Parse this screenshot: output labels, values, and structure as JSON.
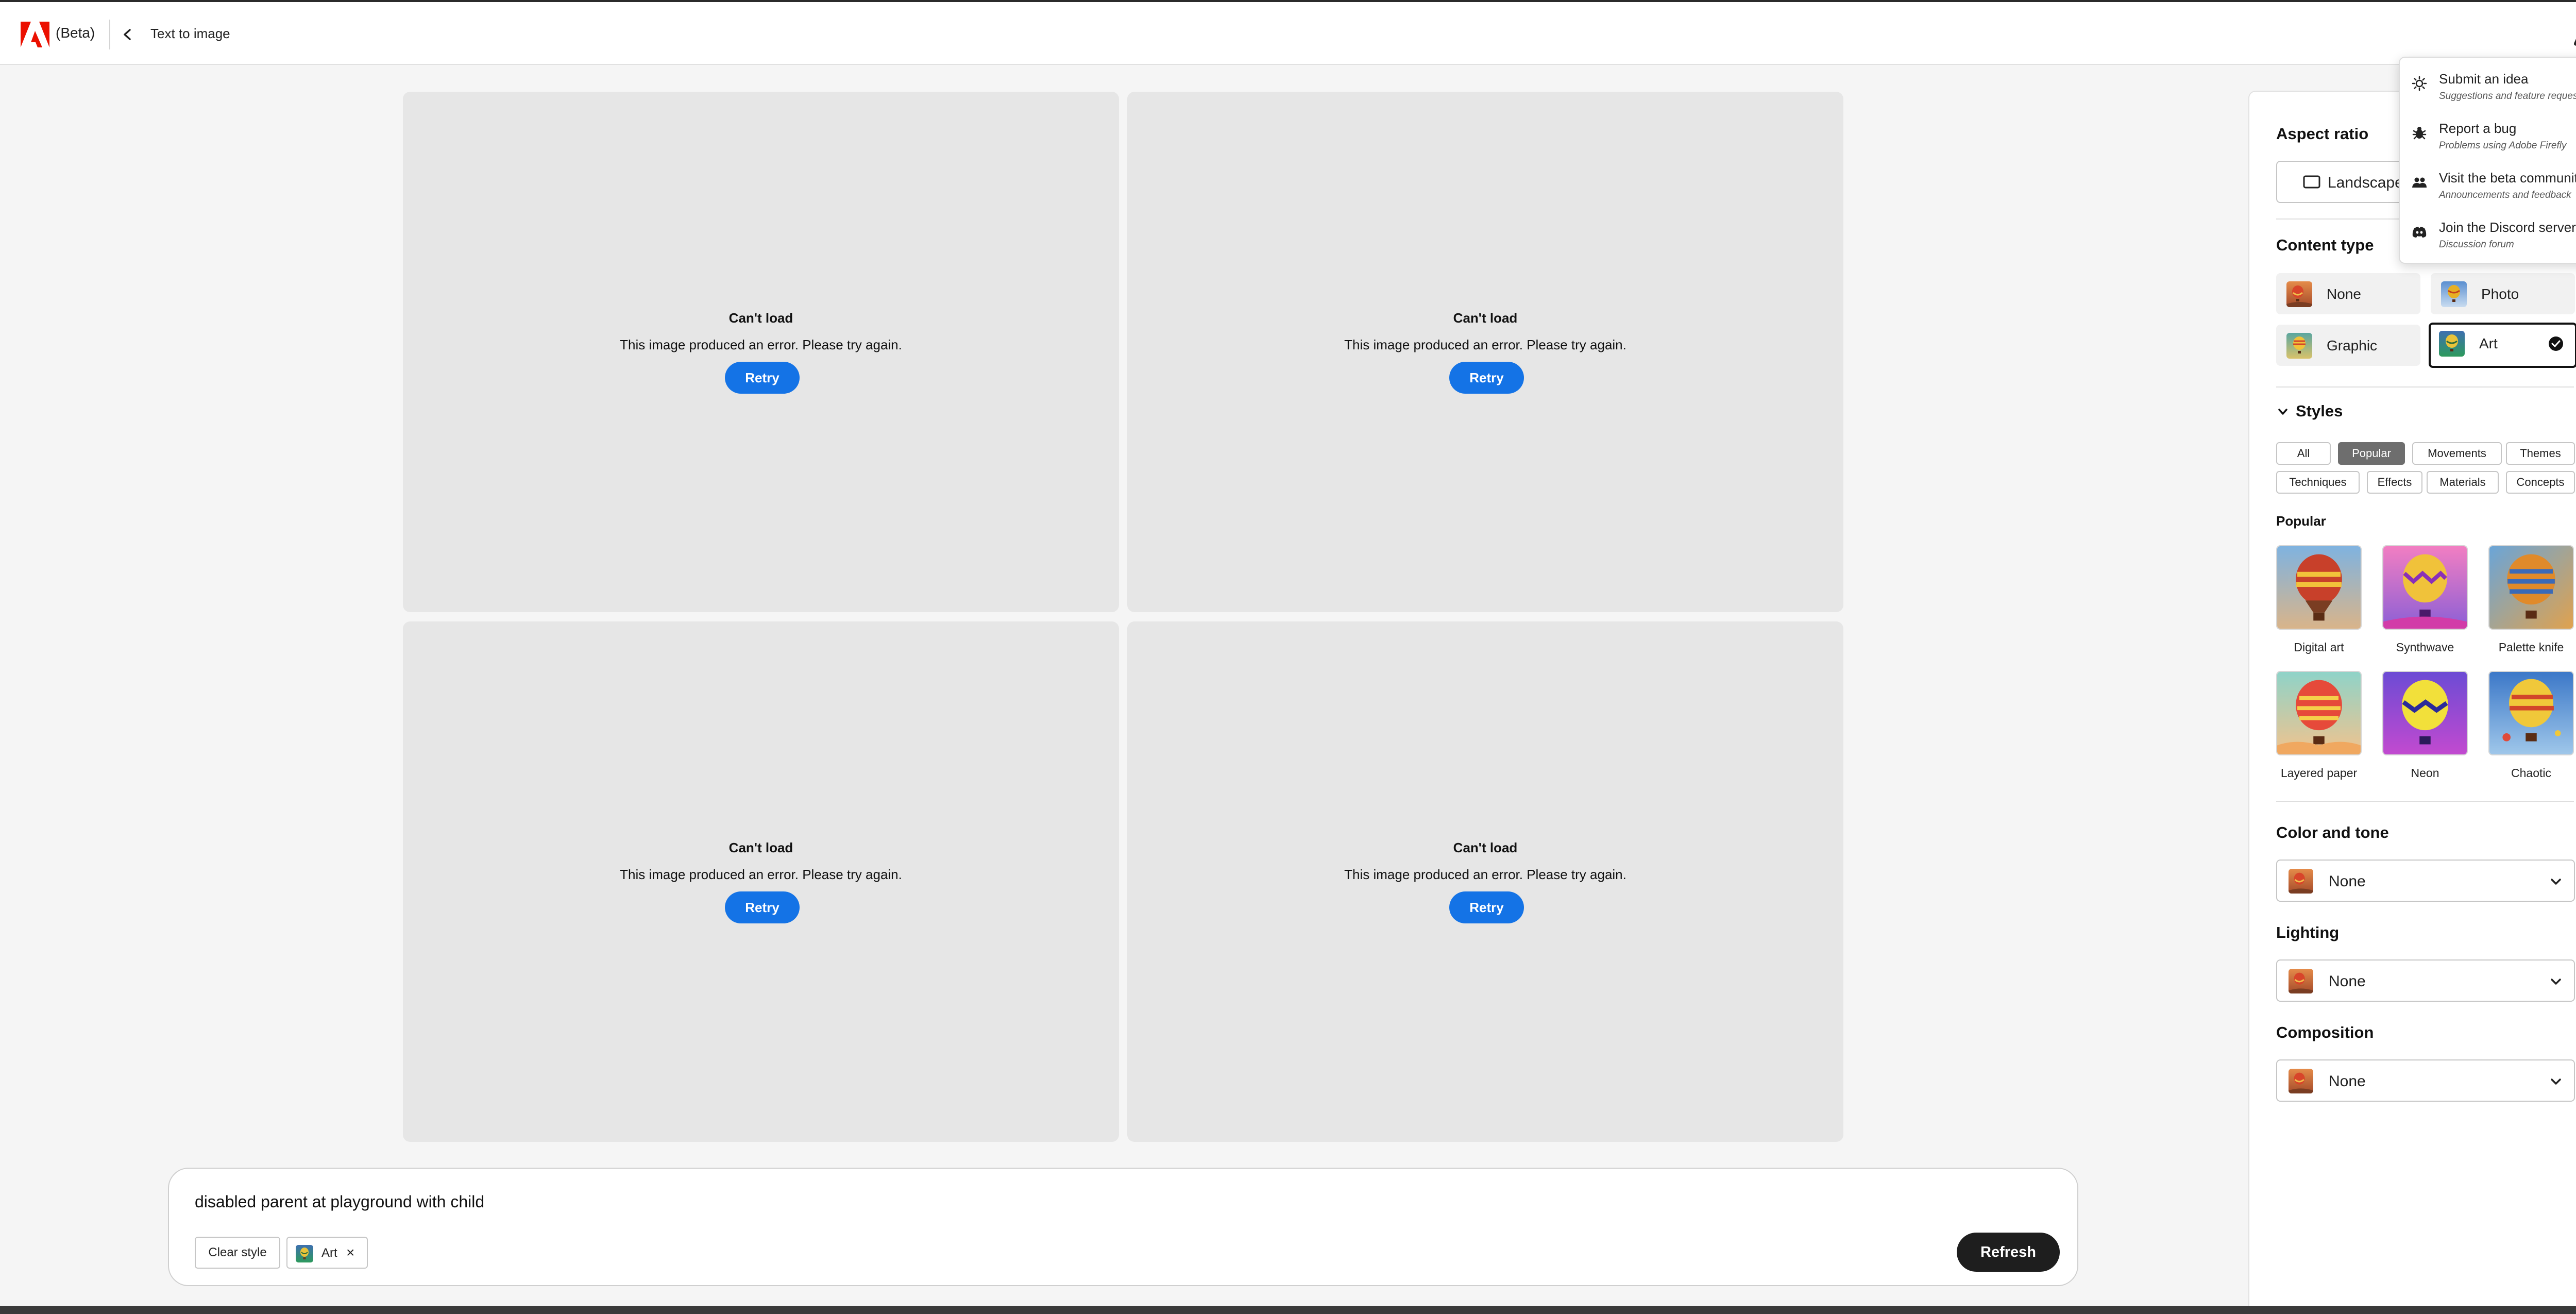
{
  "header": {
    "beta_label": "(Beta)",
    "page_title": "Text to image",
    "brand_color": "#eb1000"
  },
  "grid": {
    "tiles": [
      {
        "title": "Can't load",
        "message": "This image produced an error. Please try again.",
        "retry_label": "Retry"
      },
      {
        "title": "Can't load",
        "message": "This image produced an error. Please try again.",
        "retry_label": "Retry"
      },
      {
        "title": "Can't load",
        "message": "This image produced an error. Please try again.",
        "retry_label": "Retry"
      },
      {
        "title": "Can't load",
        "message": "This image produced an error. Please try again.",
        "retry_label": "Retry"
      }
    ]
  },
  "prompt": {
    "text": "disabled parent at playground with child",
    "clear_style_label": "Clear style",
    "chip_label": "Art",
    "chip_remove": "×",
    "refresh_label": "Refresh"
  },
  "panel": {
    "aspect_ratio": {
      "title": "Aspect ratio",
      "value": "Landscape"
    },
    "content_type": {
      "title": "Content type",
      "options": [
        {
          "label": "None",
          "selected": false
        },
        {
          "label": "Photo",
          "selected": false
        },
        {
          "label": "Graphic",
          "selected": false
        },
        {
          "label": "Art",
          "selected": true
        }
      ]
    },
    "styles": {
      "title": "Styles",
      "filters": [
        {
          "label": "All",
          "active": false
        },
        {
          "label": "Popular",
          "active": true
        },
        {
          "label": "Movements",
          "active": false
        },
        {
          "label": "Themes",
          "active": false
        },
        {
          "label": "Techniques",
          "active": false
        },
        {
          "label": "Effects",
          "active": false
        },
        {
          "label": "Materials",
          "active": false
        },
        {
          "label": "Concepts",
          "active": false
        }
      ],
      "section_title": "Popular",
      "items": [
        {
          "label": "Digital art"
        },
        {
          "label": "Synthwave"
        },
        {
          "label": "Palette knife"
        },
        {
          "label": "Layered paper"
        },
        {
          "label": "Neon"
        },
        {
          "label": "Chaotic"
        }
      ]
    },
    "color_tone": {
      "title": "Color and tone",
      "value": "None"
    },
    "lighting": {
      "title": "Lighting",
      "value": "None"
    },
    "composition": {
      "title": "Composition",
      "value": "None"
    }
  },
  "help_menu": {
    "items": [
      {
        "title": "Submit an idea",
        "subtitle": "Suggestions and feature requests",
        "icon": "lightbulb-icon"
      },
      {
        "title": "Report a bug",
        "subtitle": "Problems using Adobe Firefly",
        "icon": "bug-icon"
      },
      {
        "title": "Visit the beta community",
        "subtitle": "Announcements and feedback",
        "icon": "community-icon"
      },
      {
        "title": "Join the Discord server",
        "subtitle": "Discussion forum",
        "icon": "discord-icon"
      }
    ]
  },
  "colors": {
    "accent": "#1473e6",
    "primary_dark": "#1e1e1e",
    "tile_bg": "#e6e6e6"
  }
}
